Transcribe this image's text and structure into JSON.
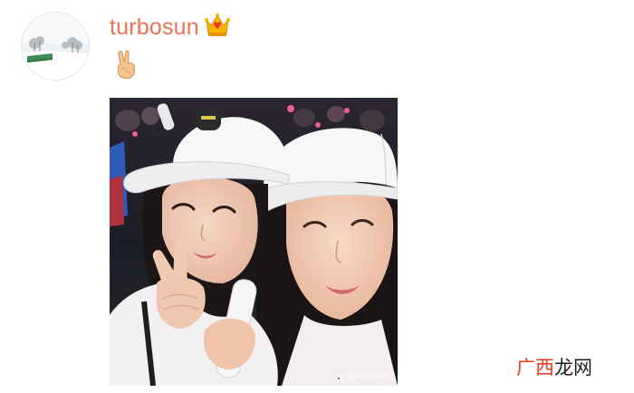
{
  "post": {
    "author": {
      "username": "turbosun",
      "badge_icon": "crown-vip-icon"
    },
    "content_emoji": "✌",
    "image": {
      "watermark": "@turbosun"
    }
  },
  "site_brand": {
    "part1": "广西",
    "part2": "龙网"
  },
  "colors": {
    "username": "#eb7350",
    "brand_accent": "#e8351b"
  }
}
